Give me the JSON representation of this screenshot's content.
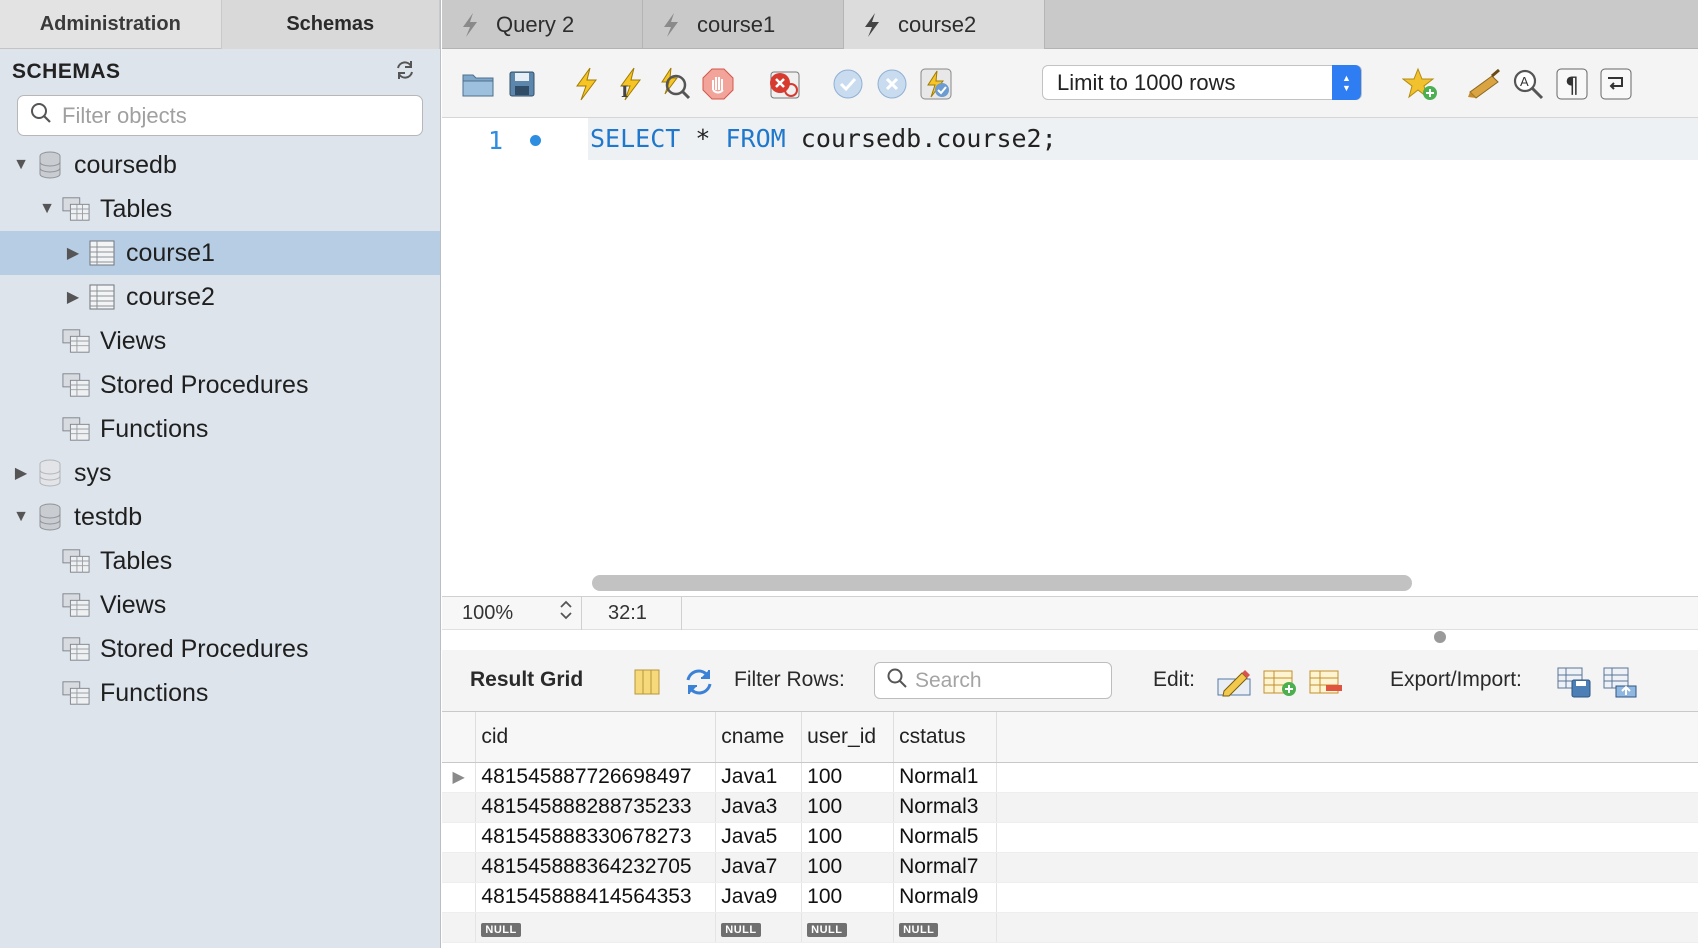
{
  "left_tabs": [
    {
      "label": "Administration",
      "active": false
    },
    {
      "label": "Schemas",
      "active": true
    }
  ],
  "schemas_header": {
    "title": "SCHEMAS",
    "refresh_icon": "refresh-icon"
  },
  "filter": {
    "placeholder": "Filter objects",
    "value": ""
  },
  "tree": [
    {
      "label": "coursedb",
      "level": 0,
      "disclosure": "expanded",
      "icon": "database-icon"
    },
    {
      "label": "Tables",
      "level": 1,
      "disclosure": "expanded",
      "icon": "folder-tables-icon"
    },
    {
      "label": "course1",
      "level": 2,
      "disclosure": "collapsed",
      "icon": "table-icon",
      "selected": true
    },
    {
      "label": "course2",
      "level": 2,
      "disclosure": "collapsed",
      "icon": "table-icon"
    },
    {
      "label": "Views",
      "level": 1,
      "disclosure": "none",
      "icon": "folder-views-icon"
    },
    {
      "label": "Stored Procedures",
      "level": 1,
      "disclosure": "none",
      "icon": "folder-procedures-icon"
    },
    {
      "label": "Functions",
      "level": 1,
      "disclosure": "none",
      "icon": "folder-functions-icon"
    },
    {
      "label": "sys",
      "level": 0,
      "disclosure": "collapsed",
      "icon": "database-icon"
    },
    {
      "label": "testdb",
      "level": 0,
      "disclosure": "expanded",
      "icon": "database-icon"
    },
    {
      "label": "Tables",
      "level": 1,
      "disclosure": "none",
      "icon": "folder-tables-icon"
    },
    {
      "label": "Views",
      "level": 1,
      "disclosure": "none",
      "icon": "folder-views-icon"
    },
    {
      "label": "Stored Procedures",
      "level": 1,
      "disclosure": "none",
      "icon": "folder-procedures-icon"
    },
    {
      "label": "Functions",
      "level": 1,
      "disclosure": "none",
      "icon": "folder-functions-icon"
    }
  ],
  "query_tabs": [
    {
      "label": "Query 2",
      "active": false
    },
    {
      "label": "course1",
      "active": false
    },
    {
      "label": "course2",
      "active": true
    }
  ],
  "toolbar": {
    "limit_label": "Limit to 1000 rows",
    "icons": [
      "open-file-icon",
      "save-icon",
      "execute-icon",
      "execute-current-icon",
      "explain-icon",
      "stop-icon",
      "toggle-errors-icon",
      "commit-icon",
      "rollback-icon",
      "autocommit-icon",
      "bookmark-add-icon",
      "beautify-icon",
      "find-icon",
      "invisible-chars-icon",
      "wrap-lines-icon"
    ]
  },
  "editor": {
    "line_number": "1",
    "code": {
      "kw1": "SELECT",
      "star": "*",
      "kw2": "FROM",
      "rest": "coursedb.course2;"
    }
  },
  "status": {
    "zoom": "100%",
    "cursor": "32:1"
  },
  "result_bar": {
    "title": "Result Grid",
    "filter_label": "Filter Rows:",
    "search_placeholder": "Search",
    "edit_label": "Edit:",
    "export_label": "Export/Import:"
  },
  "grid": {
    "columns": [
      "cid",
      "cname",
      "user_id",
      "cstatus"
    ],
    "rows": [
      [
        "481545887726698497",
        "Java1",
        "100",
        "Normal1"
      ],
      [
        "481545888288735233",
        "Java3",
        "100",
        "Normal3"
      ],
      [
        "481545888330678273",
        "Java5",
        "100",
        "Normal5"
      ],
      [
        "481545888364232705",
        "Java7",
        "100",
        "Normal7"
      ],
      [
        "481545888414564353",
        "Java9",
        "100",
        "Normal9"
      ]
    ],
    "null_row": [
      "NULL",
      "NULL",
      "NULL",
      "NULL"
    ]
  },
  "colors": {
    "accent": "#2f7df3",
    "selection": "#b7cde3",
    "sidebar": "#dde4ec",
    "keyword": "#1f78cc"
  }
}
